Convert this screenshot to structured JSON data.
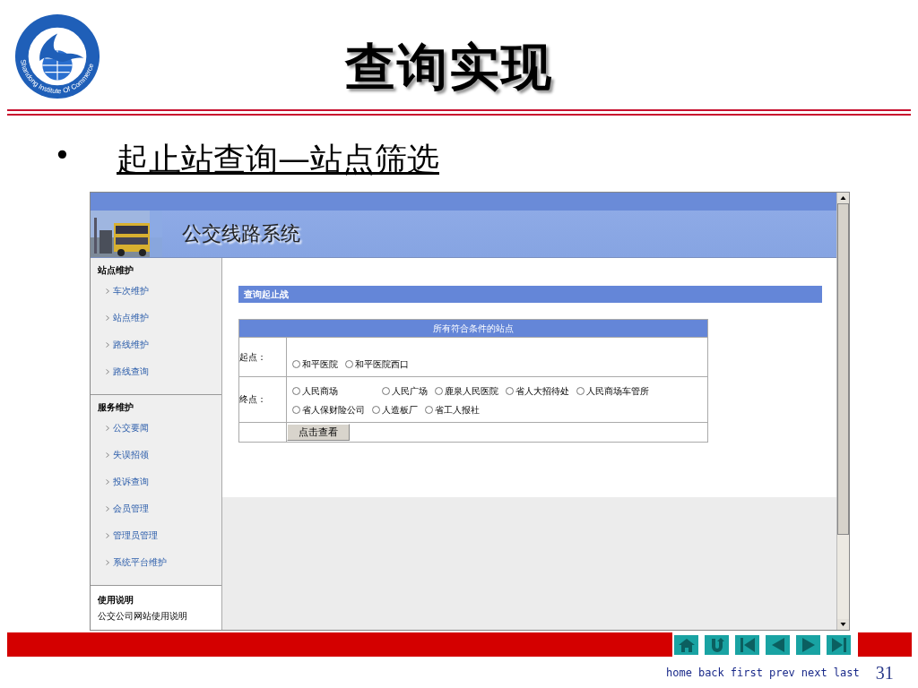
{
  "slide": {
    "logo_text": "Shandong Institute Of Commerce",
    "title": "查询实现",
    "bullet": "•",
    "subtitle": "起止站查询—站点筛选",
    "page_number": "31"
  },
  "app": {
    "title": "公交线路系统",
    "sidebar": [
      {
        "heading": "站点维护",
        "items": [
          "车次维护",
          "站点维护",
          "路线维护",
          "路线查询"
        ]
      },
      {
        "heading": "服务维护",
        "items": [
          "公交要闻",
          "失误招领",
          "投诉查询",
          "会员管理",
          "管理员管理",
          "系统平台维护"
        ]
      }
    ],
    "help": {
      "heading": "使用说明",
      "text": "公交公司网站使用说明"
    },
    "panel_title": "查询起止战",
    "table": {
      "caption": "所有符合条件的站点",
      "rows": [
        {
          "label": "起点：",
          "lines": [
            [
              {
                "label": "和平医院",
                "selected": false
              },
              {
                "label": "和平医院西口",
                "selected": false
              }
            ]
          ]
        },
        {
          "label": "终点：",
          "lines": [
            [
              {
                "label": "人民商场",
                "selected": false
              },
              {
                "label": "人民广场",
                "selected": false
              },
              {
                "label": "鹿泉人民医院",
                "selected": false
              },
              {
                "label": "省人大招待处",
                "selected": false
              },
              {
                "label": "人民商场车管所",
                "selected": false
              }
            ],
            [
              {
                "label": "省人保财险公司",
                "selected": false
              },
              {
                "label": "人造板厂",
                "selected": false
              },
              {
                "label": "省工人报社",
                "selected": false
              }
            ]
          ]
        }
      ],
      "button": "点击查看"
    }
  },
  "nav": [
    {
      "kind": "home",
      "label": "home"
    },
    {
      "kind": "back",
      "label": "back"
    },
    {
      "kind": "first",
      "label": "first"
    },
    {
      "kind": "prev",
      "label": "prev"
    },
    {
      "kind": "next",
      "label": "next"
    },
    {
      "kind": "last",
      "label": "last"
    }
  ]
}
